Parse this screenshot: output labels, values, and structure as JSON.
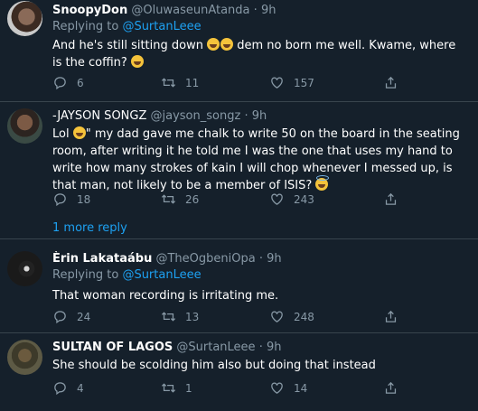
{
  "tweets": [
    {
      "name": "SnoopyDon",
      "handle": "@OluwaseunAtanda",
      "dot": "·",
      "time": "9h",
      "replying_label": "Replying to",
      "replying_to": "@SurtanLeee",
      "text_before": "And he's still sitting down ",
      "emojis_mid": [
        "face-with-tears-of-joy",
        "face-with-tears-of-joy"
      ],
      "text_mid": " dem no born me well. Kwame, where is the coffin? ",
      "emoji_end": "face-with-tears-of-joy",
      "replies": "6",
      "retweets": "11",
      "likes": "157"
    },
    {
      "name": "-JAYSON SONGZ",
      "handle": "@jayson_songz",
      "dot": "·",
      "time": "9h",
      "text_start": "Lol ",
      "emoji_start": "face-with-tears-of-joy",
      "text_body": "\" my dad gave me chalk to write 50 on the board in the seating room, after writing it he told me I was the one that uses my hand to write how many strokes of kain I will chop whenever I messed up, is that man, not likely to be a member of ISIS? ",
      "emoji_end": "smiling-face-with-halo",
      "replies": "18",
      "retweets": "26",
      "likes": "243",
      "more_replies": "1 more reply"
    },
    {
      "name": "Èrin Lakataábu",
      "handle": "@TheOgbeniOpa",
      "dot": "·",
      "time": "9h",
      "replying_label": "Replying to",
      "replying_to": "@SurtanLeee",
      "text": "That woman recording is irritating me.",
      "replies": "24",
      "retweets": "13",
      "likes": "248"
    },
    {
      "name": "SULTAN OF LAGOS",
      "handle": "@SurtanLeee",
      "dot": "·",
      "time": "9h",
      "text": "She should be scolding him also but doing that instead",
      "replies": "4",
      "retweets": "1",
      "likes": "14"
    }
  ]
}
